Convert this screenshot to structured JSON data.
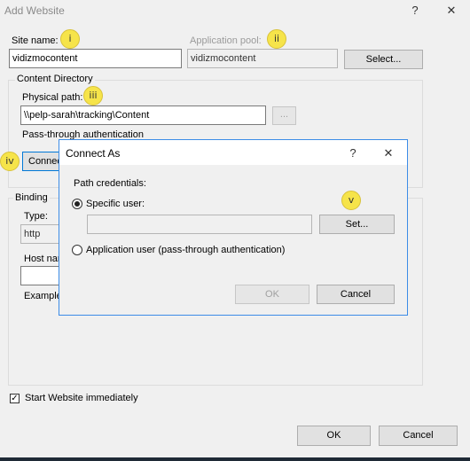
{
  "window": {
    "title": "Add Website",
    "help_glyph": "?",
    "close_glyph": "✕"
  },
  "site": {
    "site_name_label": "Site name:",
    "site_name_value": "vidizmocontent",
    "app_pool_label": "Application pool:",
    "app_pool_value": "vidizmocontent",
    "select_button": "Select..."
  },
  "content_directory": {
    "group_label": "Content Directory",
    "physical_path_label": "Physical path:",
    "physical_path_value": "\\\\pelp-sarah\\tracking\\Content",
    "browse_button": "...",
    "pass_through_label": "Pass-through authentication",
    "connect_as_button": "Connect"
  },
  "binding": {
    "group_label": "Binding",
    "type_label": "Type:",
    "type_value": "http",
    "host_name_label": "Host nam",
    "example_label": "Example"
  },
  "start_immediately": {
    "label": "Start Website immediately",
    "checked": true
  },
  "footer": {
    "ok": "OK",
    "cancel": "Cancel"
  },
  "badges": {
    "i": "i",
    "ii": "ii",
    "iii": "iii",
    "iv": "iv",
    "v": "v"
  },
  "connect_as_dialog": {
    "title": "Connect As",
    "help_glyph": "?",
    "close_glyph": "✕",
    "path_credentials_label": "Path credentials:",
    "specific_user_label": "Specific user:",
    "specific_user_value": "",
    "specific_user_selected": true,
    "set_button": "Set...",
    "app_user_label": "Application user (pass-through authentication)",
    "ok": "OK",
    "cancel": "Cancel"
  },
  "colors": {
    "badge": "#f6e44a",
    "dialog_border": "#3c8ce7",
    "primary_button_border": "#0078d7"
  }
}
